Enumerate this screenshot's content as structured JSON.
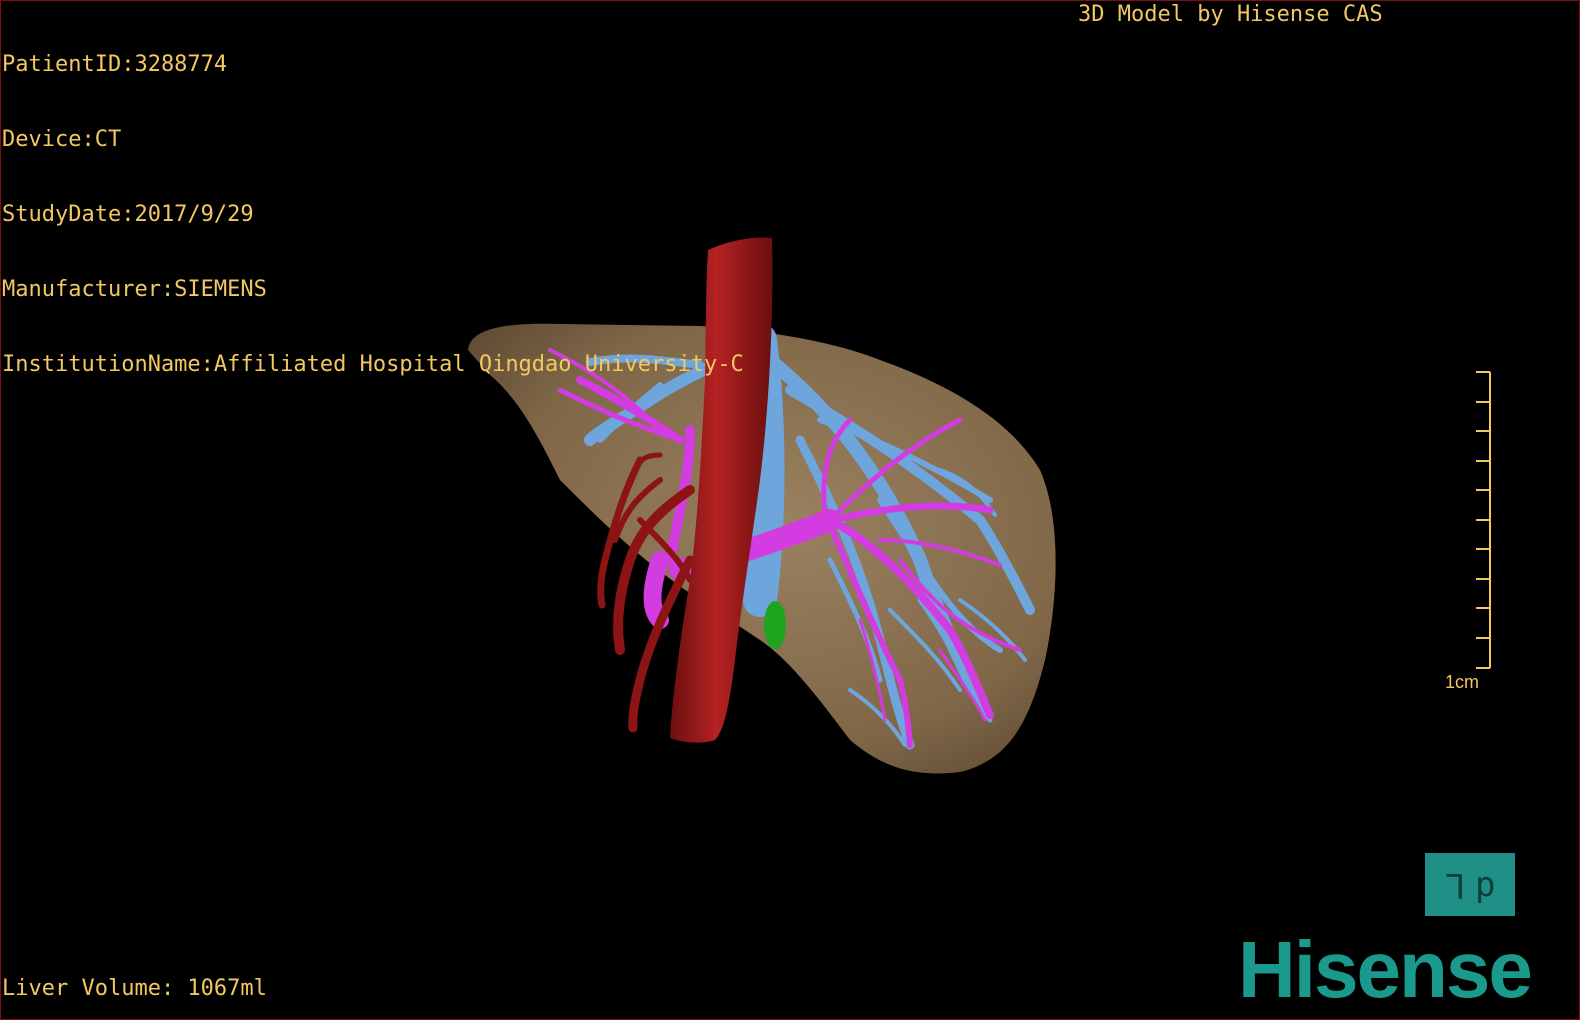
{
  "overlay": {
    "patient_id": "PatientID:3288774",
    "device": "Device:CT",
    "study_date": "StudyDate:2017/9/29",
    "manufacturer": "Manufacturer:SIEMENS",
    "institution": "InstitutionName:Affiliated Hospital Qingdao University-C",
    "credit": "3D Model by Hisense CAS",
    "liver_volume": "Liver Volume: 1067ml"
  },
  "scale_bar": {
    "label": "1cm"
  },
  "orientation_marker": {
    "left_glyph": "L",
    "right_glyph": "p"
  },
  "brand": {
    "logo_text": "Hisense"
  },
  "colors": {
    "text": "#f2c860",
    "liver": "#8b7254",
    "hepatic_vein": "#6fa5dd",
    "portal_vein": "#d33ce0",
    "artery": "#9c1818",
    "lesion": "#1ea51e",
    "logo": "#1a9a8c"
  }
}
